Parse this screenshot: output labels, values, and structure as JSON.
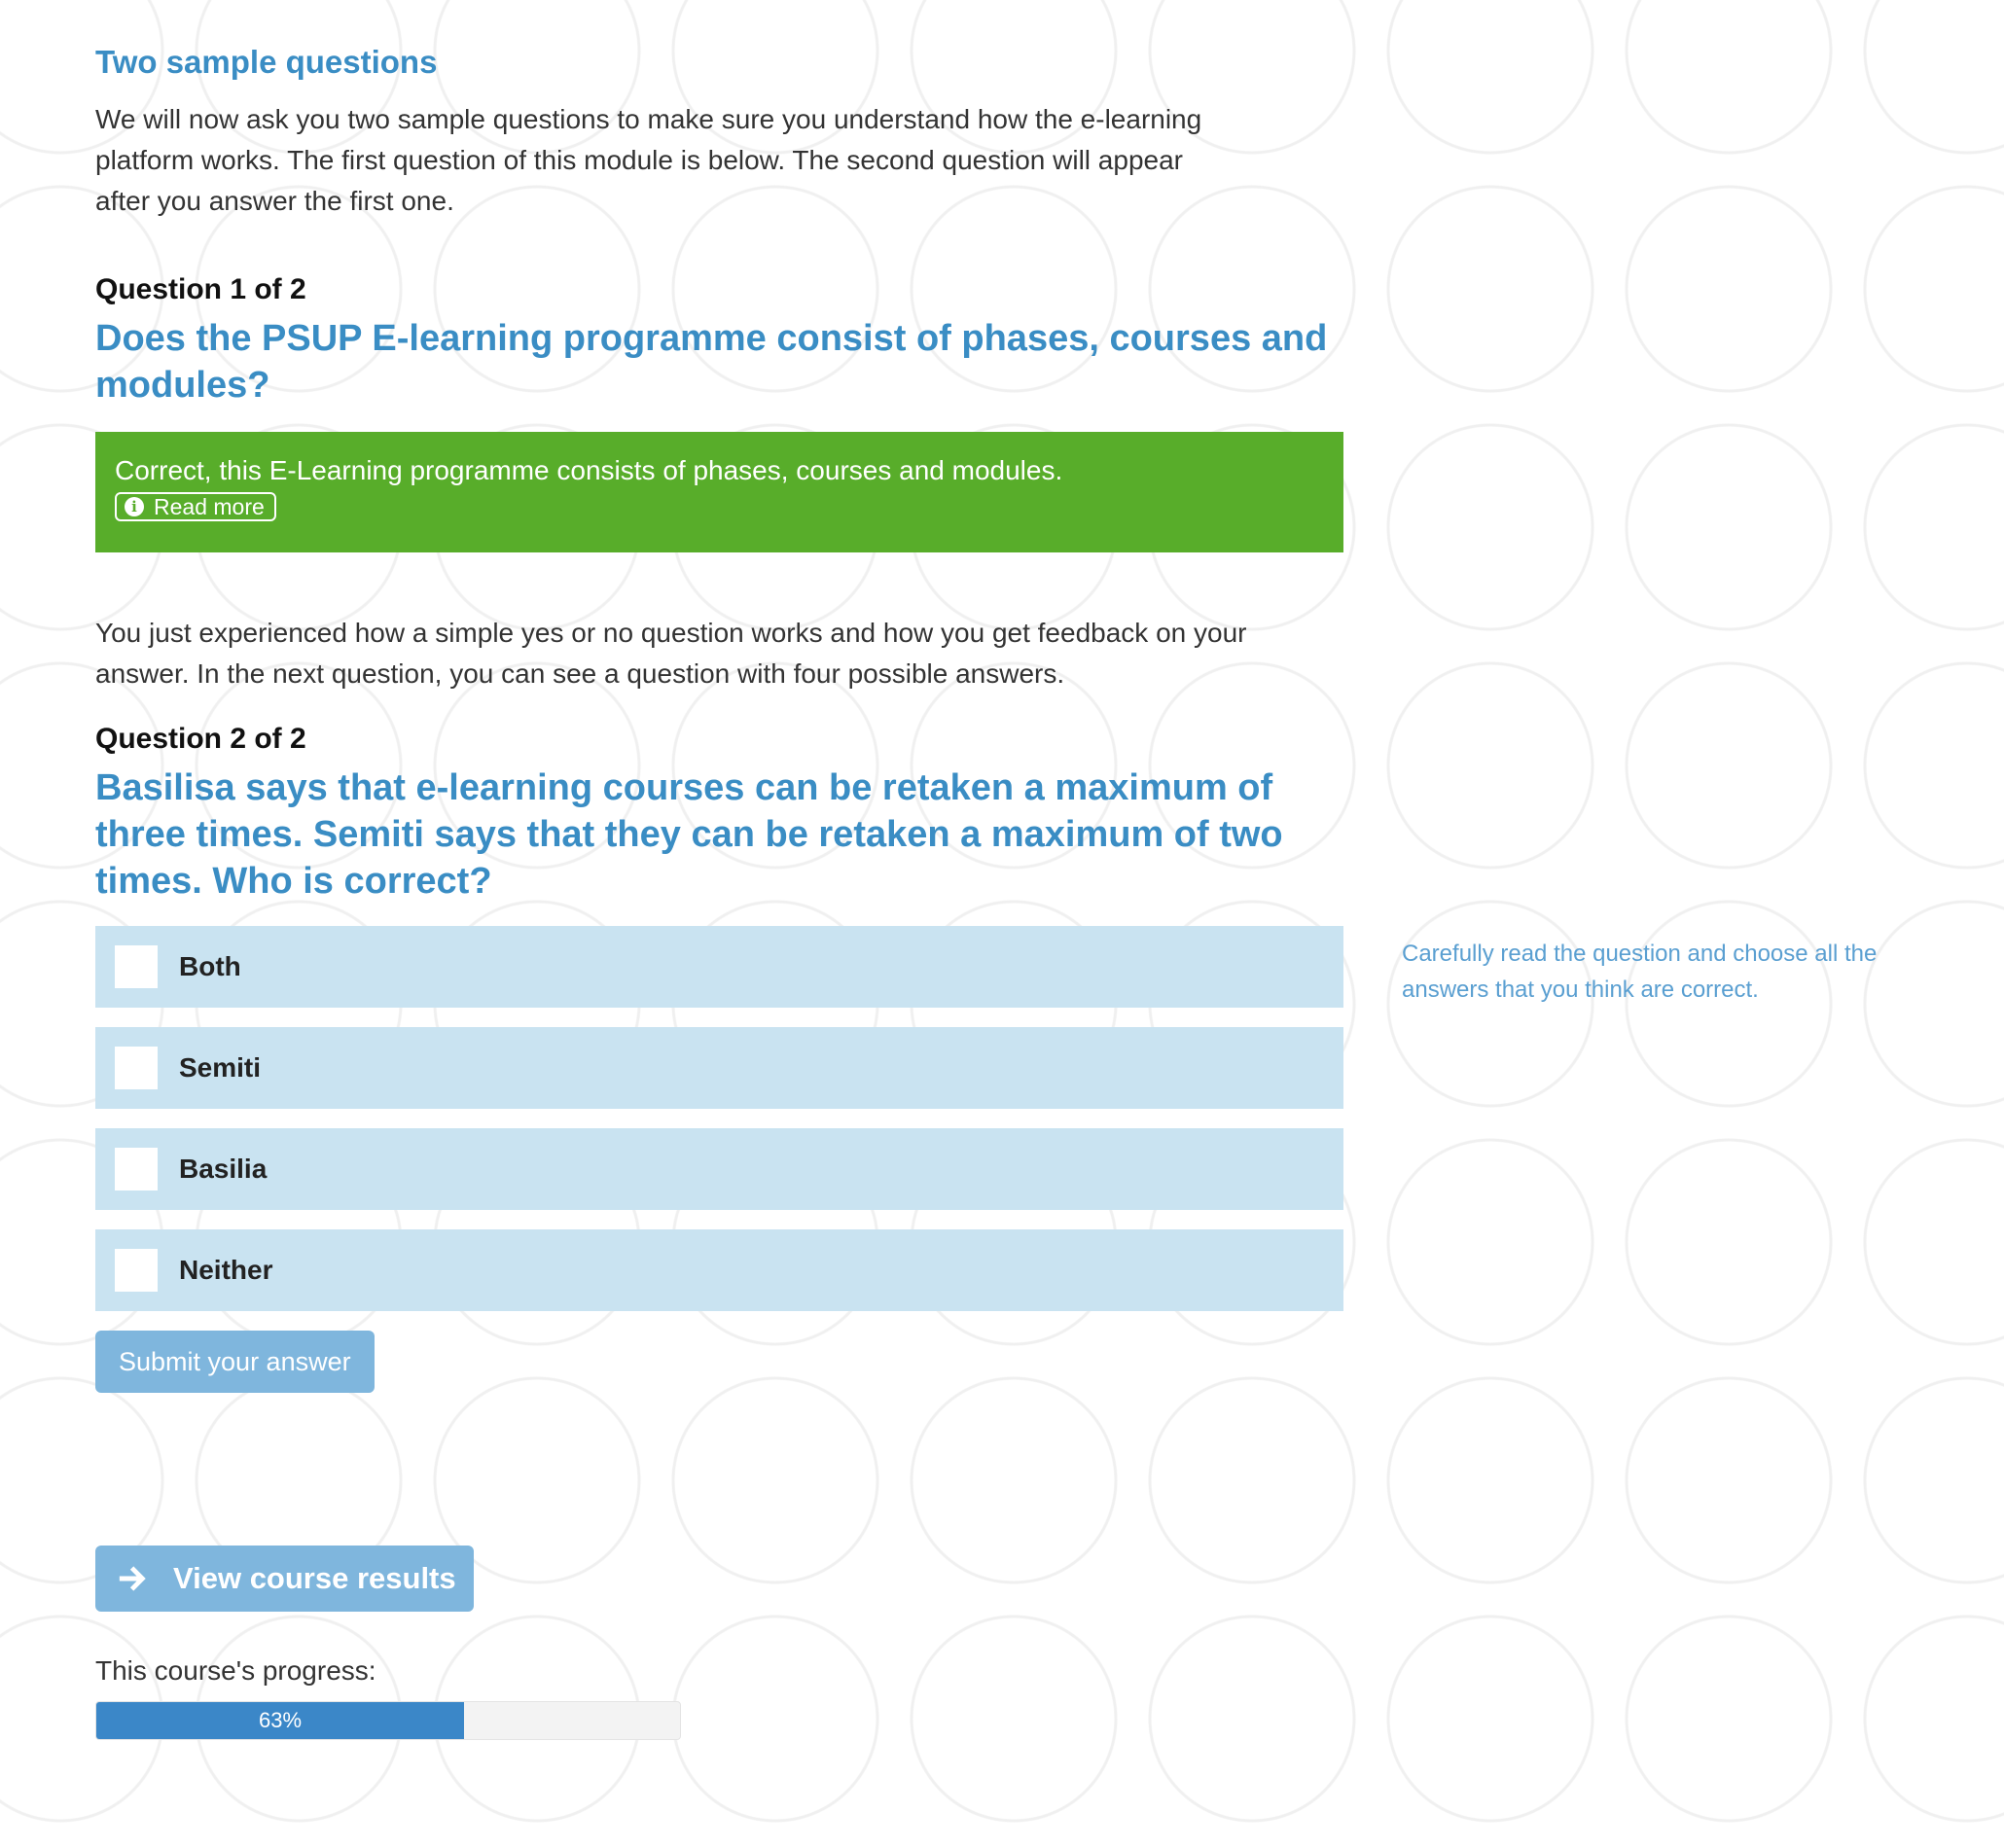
{
  "section": {
    "title": "Two sample questions",
    "intro": "We will now ask you two sample questions to make sure you understand how the e-learning platform works. The first question of this module is below. The second question will appear after you answer the first one."
  },
  "question1": {
    "label": "Question 1 of 2",
    "text": "Does the PSUP E-learning programme consist of phases, courses and modules?",
    "feedback": "Correct, this E-Learning programme consists of phases, courses and modules.",
    "read_more_label": "Read more"
  },
  "explanation": "You just experienced how a simple yes or no question works and how you get feedback on your answer. In the next question, you can see a question with four possible answers.",
  "question2": {
    "label": "Question 2 of 2",
    "text": "Basilisa says that e-learning courses can be retaken a maximum of three times. Semiti says that they can be retaken a maximum of two times. Who is correct?",
    "answers": [
      {
        "label": "Both",
        "checked": false
      },
      {
        "label": "Semiti",
        "checked": false
      },
      {
        "label": "Basilia",
        "checked": false
      },
      {
        "label": "Neither",
        "checked": false
      }
    ],
    "submit_label": "Submit your answer",
    "hint": "Carefully read the question and choose all the answers that you think are correct."
  },
  "course_results_label": "View course results",
  "progress": {
    "label": "This course's progress:",
    "value": 63,
    "value_text": "63%"
  },
  "colors": {
    "accent": "#3a8dc4",
    "correct_bg": "#58ad2a",
    "answer_bg": "#c9e3f1",
    "button_bg": "#7fb6dd",
    "progress_fill": "#3b87c8"
  }
}
